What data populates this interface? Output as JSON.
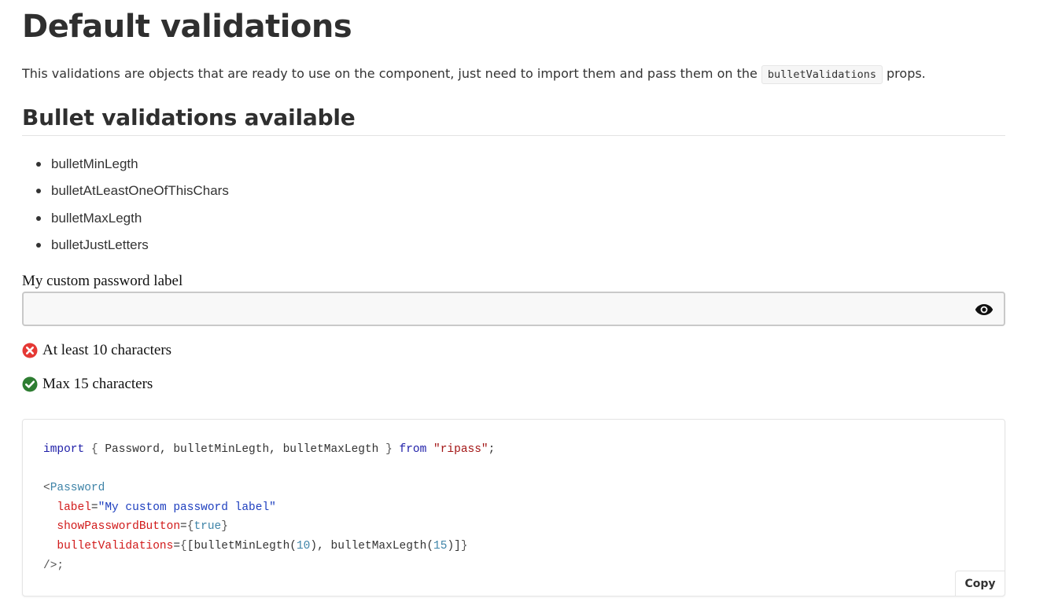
{
  "page": {
    "title": "Default validations",
    "intro_before": "This validations are objects that are ready to use on the component, just need to import them and pass them on the",
    "intro_code": "bulletValidations",
    "intro_after": "props.",
    "subtitle": "Bullet validations available"
  },
  "bullets": [
    "bulletMinLegth",
    "bulletAtLeastOneOfThisChars",
    "bulletMaxLegth",
    "bulletJustLetters"
  ],
  "password_field": {
    "label": "My custom password label",
    "value": "",
    "toggle_icon": "eye-icon"
  },
  "validation_rules": [
    {
      "text": "At least 10 characters",
      "status": "fail",
      "icon": "x-circle-icon",
      "color": "#e53935"
    },
    {
      "text": "Max 15 characters",
      "status": "pass",
      "icon": "check-circle-icon",
      "color": "#2e7d32"
    }
  ],
  "code_example": {
    "line1": {
      "import": "import",
      "open": "{",
      "names": "Password, bulletMinLegth, bulletMaxLegth",
      "close": "}",
      "from": "from",
      "module": "\"ripass\"",
      "semi": ";"
    },
    "tag_open": "<",
    "component": "Password",
    "label_attr": "label",
    "label_value": "\"My custom password label\"",
    "show_attr": "showPasswordButton",
    "show_value": "true",
    "bullets_attr": "bulletValidations",
    "call1": "bulletMinLegth",
    "arg1": "10",
    "call2": "bulletMaxLegth",
    "arg2": "15",
    "tag_close": "/>;",
    "copy_label": "Copy"
  }
}
